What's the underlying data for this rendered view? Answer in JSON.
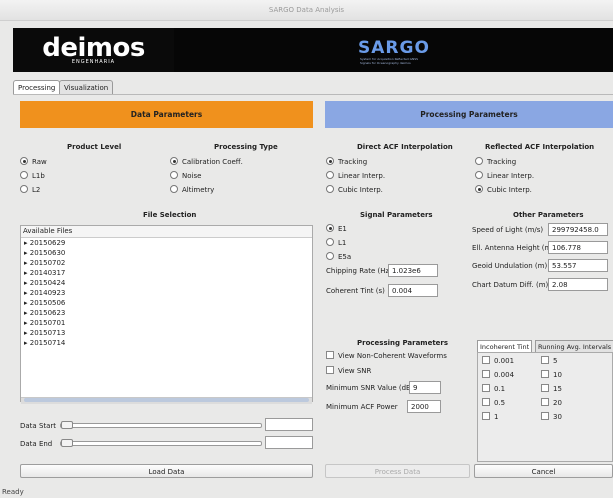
{
  "window": {
    "title": "SARGO Data Analysis"
  },
  "banner": {
    "left_logo_text": "deimos",
    "left_logo_sub": "ENGENHARIA",
    "right_logo_text": "SARGO",
    "right_logo_sub": "System for Acquisition Reflected GNSS Signals for Oceanography deimos"
  },
  "tabs": [
    {
      "label": "Processing",
      "active": true
    },
    {
      "label": "Visualization",
      "active": false
    }
  ],
  "data_params": {
    "header": "Data Parameters",
    "product_level": {
      "title": "Product Level",
      "options": [
        {
          "label": "Raw",
          "selected": true
        },
        {
          "label": "L1b",
          "selected": false
        },
        {
          "label": "L2",
          "selected": false
        }
      ]
    },
    "processing_type": {
      "title": "Processing Type",
      "options": [
        {
          "label": "Calibration Coeff.",
          "selected": true
        },
        {
          "label": "Noise",
          "selected": false
        },
        {
          "label": "Altimetry",
          "selected": false
        }
      ]
    },
    "file_selection": {
      "title": "File Selection",
      "list_header": "Available Files",
      "files": [
        "20150629",
        "20150630",
        "20150702",
        "20140317",
        "20150424",
        "20140923",
        "20150506",
        "20150623",
        "20150701",
        "20150713",
        "20150714"
      ]
    },
    "data_start_label": "Data Start",
    "data_end_label": "Data End",
    "data_start_value": "",
    "data_end_value": "",
    "load_button": "Load Data"
  },
  "proc_params": {
    "header": "Processing Parameters",
    "direct_acf": {
      "title": "Direct ACF Interpolation",
      "options": [
        {
          "label": "Tracking",
          "selected": true
        },
        {
          "label": "Linear Interp.",
          "selected": false
        },
        {
          "label": "Cubic Interp.",
          "selected": false
        }
      ]
    },
    "reflected_acf": {
      "title": "Reflected ACF Interpolation",
      "options": [
        {
          "label": "Tracking",
          "selected": false
        },
        {
          "label": "Linear Interp.",
          "selected": false
        },
        {
          "label": "Cubic Interp.",
          "selected": true
        }
      ]
    },
    "signal": {
      "title": "Signal Parameters",
      "options": [
        {
          "label": "E1",
          "selected": true
        },
        {
          "label": "L1",
          "selected": false
        },
        {
          "label": "E5a",
          "selected": false
        }
      ],
      "chipping_rate_label": "Chipping Rate (Hz)",
      "chipping_rate_value": "1.023e6",
      "coherent_tint_label": "Coherent Tint (s)",
      "coherent_tint_value": "0.004"
    },
    "other": {
      "title": "Other Parameters",
      "speed_of_light_label": "Speed of Light (m/s)",
      "speed_of_light_value": "299792458.0",
      "antenna_height_label": "Ell. Antenna Height (m)",
      "antenna_height_value": "106.778",
      "geoid_label": "Geoid Undulation (m)",
      "geoid_value": "53.557",
      "chart_datum_label": "Chart Datum Diff. (m)",
      "chart_datum_value": "2.08"
    },
    "processing": {
      "title": "Processing Parameters",
      "view_noncoherent_label": "View Non-Coherent Waveforms",
      "view_snr_label": "View SNR",
      "min_snr_label": "Minimum SNR Value (dB)",
      "min_snr_value": "9",
      "min_acf_label": "Minimum ACF Power",
      "min_acf_value": "2000"
    },
    "tint_tabs": [
      "Incoherent Tint",
      "Running Avg. Intervals"
    ],
    "incoherent_tint_values": [
      "0.001",
      "0.004",
      "0.1",
      "0.5",
      "1"
    ],
    "running_avg_values": [
      "5",
      "10",
      "15",
      "20",
      "30"
    ],
    "process_button": "Process Data",
    "cancel_button": "Cancel"
  },
  "status": {
    "text": "Ready"
  }
}
